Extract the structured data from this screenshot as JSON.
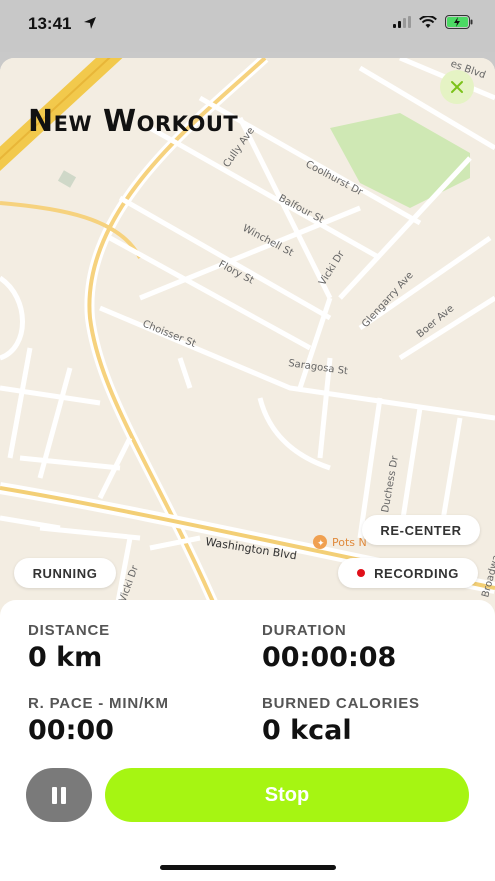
{
  "status": {
    "time": "13:41"
  },
  "header": {
    "title": "New Workout"
  },
  "map": {
    "streets": [
      "Cully Ave",
      "Coolhurst Dr",
      "Balfour St",
      "Winchell St",
      "Flory St",
      "Vicki Dr",
      "Glengarry Ave",
      "Boer Ave",
      "Choisser St",
      "Saragosa St",
      "Duchess Dr",
      "Washington Blvd",
      "Vicki Dr",
      "Broadwa",
      "es Blvd"
    ],
    "poi": "Pots N"
  },
  "controls": {
    "recenter_label": "RE-CENTER",
    "activity_label": "RUNNING",
    "recording_label": "RECORDING"
  },
  "stats": {
    "distance": {
      "label": "DISTANCE",
      "value": "0 km"
    },
    "duration": {
      "label": "DURATION",
      "value": "00:00:08"
    },
    "pace": {
      "label": "R. PACE - MIN/KM",
      "value": "00:00"
    },
    "calories": {
      "label": "BURNED CALORIES",
      "value": "0 kcal"
    }
  },
  "actions": {
    "stop_label": "Stop"
  },
  "colors": {
    "accent": "#a6f512",
    "recording": "#e0101a",
    "pause": "#7a7a7a"
  }
}
